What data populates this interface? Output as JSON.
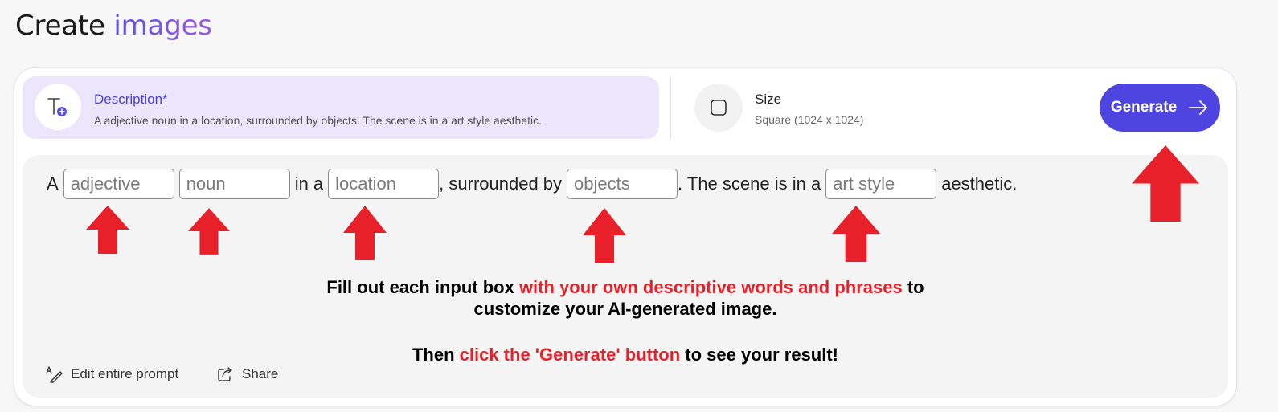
{
  "header": {
    "title_plain": "Create",
    "title_accent": "images"
  },
  "description": {
    "label": "Description*",
    "text": "A adjective noun in a location, surrounded by objects. The scene is in a art style aesthetic."
  },
  "size": {
    "label": "Size",
    "value": "Square (1024 x 1024)"
  },
  "generate": {
    "label": "Generate"
  },
  "prompt": {
    "w1": "A",
    "adjective_placeholder": "adjective",
    "noun_placeholder": "noun",
    "w2": "in a",
    "location_placeholder": "location",
    "w3": ", surrounded by",
    "objects_placeholder": "objects",
    "w4": ". The scene is in a",
    "art_style_placeholder": "art style",
    "w5": "aesthetic."
  },
  "instructions": {
    "line1_a": "Fill out each input box ",
    "line1_red": "with your own descriptive words and phrases",
    "line1_b": " to",
    "line2": "customize your AI-generated image.",
    "line3_a": "Then ",
    "line3_red": "click the 'Generate' button",
    "line3_b": " to see your result!"
  },
  "footer": {
    "edit_label": "Edit entire prompt",
    "share_label": "Share"
  },
  "colors": {
    "accent": "#4e45e0",
    "panel": "#ece6fc",
    "annotation_red": "#e8202a"
  },
  "icons": [
    "text-add-icon",
    "square-icon",
    "arrow-right-icon",
    "edit-prompt-icon",
    "share-icon",
    "red-up-arrow-icon"
  ]
}
